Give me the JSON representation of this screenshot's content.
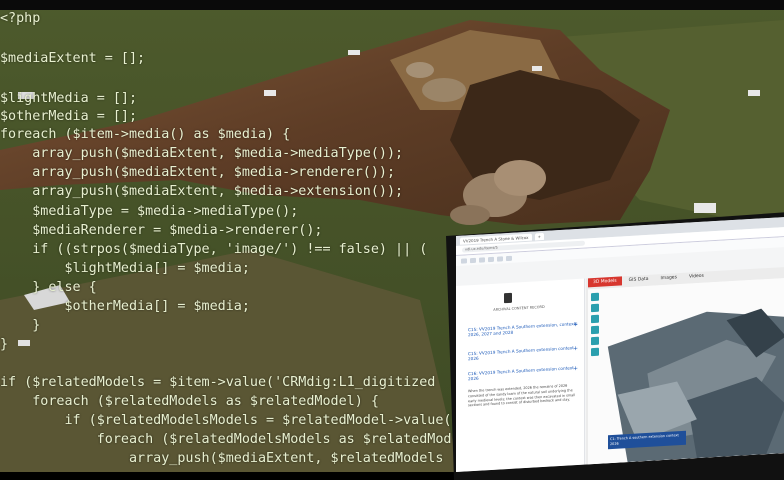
{
  "code": {
    "lines": [
      "<?php",
      "$mediaExtent = [];",
      "$lightMedia = [];",
      "$otherMedia = [];",
      "foreach ($item->media() as $media) {",
      "    array_push($mediaExtent, $media->mediaType());",
      "    array_push($mediaExtent, $media->renderer());",
      "    array_push($mediaExtent, $media->extension());",
      "    $mediaType = $media->mediaType();",
      "    $mediaRenderer = $media->renderer();",
      "    if ((strpos($mediaType, 'image/') !== false) || (",
      "        $lightMedia[] = $media;",
      "    } else {",
      "        $otherMedia[] = $media;",
      "    }",
      "}",
      "if ($relatedModels = $item->value('CRMdig:L1_digitized",
      "    foreach ($relatedModels as $relatedModel) {",
      "        if ($relatedModelsModels = $relatedModel->value(",
      "            foreach ($relatedModelsModels as $relatedMod",
      "                array_push($mediaExtent, $relatedModels"
    ]
  },
  "laptop": {
    "browser_tab": "VV2019 Trench A Stone & Wilcox",
    "address": "vdl.ux.edu/items/5",
    "left_panel": {
      "caption": "ARCHIVAL CONTENT RECORD",
      "items": [
        "C15: VV2019 Trench A Southern extension, contexts 2026, 2027 and 2028",
        "C15: VV2019 Trench A Southern extension context 2026",
        "C16: VV2019 Trench A Southern extension context 2026"
      ],
      "description": "When the trench was extended, 2026 the remains of 2026 consisted of the sandy loam of the natural soil underlying the early medieval levels; the context was then excavated in small sections and found to consist of disturbed bedrock and clay."
    },
    "view_tabs": [
      "3D Models",
      "GIS Data",
      "Images",
      "Videos"
    ],
    "active_tab": "3D Models",
    "model_caption": "C1: Trench A southern extension context 2026",
    "colors": {
      "accent": "#d7372f",
      "tool": "#2a9fae",
      "caption_bg": "#1f4f9a"
    }
  }
}
